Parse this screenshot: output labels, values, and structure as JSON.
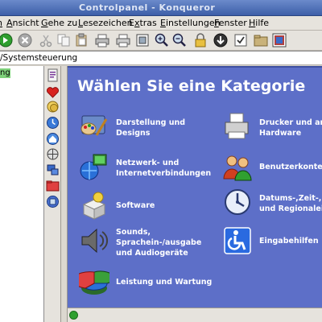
{
  "window": {
    "title": "Controlpanel - Konqueror"
  },
  "menubar": {
    "items": [
      {
        "prefix": "",
        "underlined": "n",
        "rest": ""
      },
      {
        "prefix": "",
        "underlined": "A",
        "rest": "nsicht"
      },
      {
        "prefix": "",
        "underlined": "G",
        "rest": "ehe zu"
      },
      {
        "prefix": "",
        "underlined": "L",
        "rest": "esezeichen"
      },
      {
        "prefix": "E",
        "underlined": "x",
        "rest": "tras"
      },
      {
        "prefix": "",
        "underlined": "E",
        "rest": "instellungen"
      },
      {
        "prefix": "",
        "underlined": "F",
        "rest": "enster"
      },
      {
        "prefix": "",
        "underlined": "H",
        "rest": "ilfe"
      }
    ]
  },
  "toolbar": {
    "icons": [
      "forward-icon",
      "stop-icon",
      "cut-icon",
      "copy-icon",
      "paste-icon",
      "print-icon",
      "print-preview-icon",
      "zoom-full-icon",
      "zoom-in-icon",
      "zoom-out-icon",
      "lock-icon",
      "download-icon",
      "checkbox-icon",
      "fullscreen-icon"
    ]
  },
  "location": {
    "url": "/Systemsteuerung"
  },
  "tree": {
    "selected": "ng"
  },
  "sidebar": {
    "tabs": [
      "document-icon",
      "bookmarks-heart-icon",
      "history-icon",
      "home-icon",
      "network-icon",
      "devices-icon",
      "folder-icon",
      "help-icon"
    ]
  },
  "content": {
    "heading": "Wählen Sie eine Kategorie",
    "categories": [
      {
        "label": "Darstellung und\nDesigns",
        "icon": "display-themes-icon"
      },
      {
        "label": "Netzwerk- und\nInternetverbindungen",
        "icon": "network-connections-icon"
      },
      {
        "label": "Software",
        "icon": "software-icon"
      },
      {
        "label": "Sounds,\nSprachein-/ausgabe\nund Audiogeräte",
        "icon": "speaker-icon"
      },
      {
        "label": "Leistung und Wartung",
        "icon": "performance-icon"
      },
      {
        "label": "Drucker und and\nHardware",
        "icon": "printer-icon"
      },
      {
        "label": "Benutzerkonten",
        "icon": "users-icon"
      },
      {
        "label": "Datums-,Zeit-,S\nund Regionalein",
        "icon": "clock-icon"
      },
      {
        "label": "Eingabehilfen",
        "icon": "accessibility-icon"
      }
    ]
  },
  "colors": {
    "content_bg": "#5d6fc8",
    "titlebar": "#3d5fa8",
    "tree_highlight": "#7ed17a"
  }
}
